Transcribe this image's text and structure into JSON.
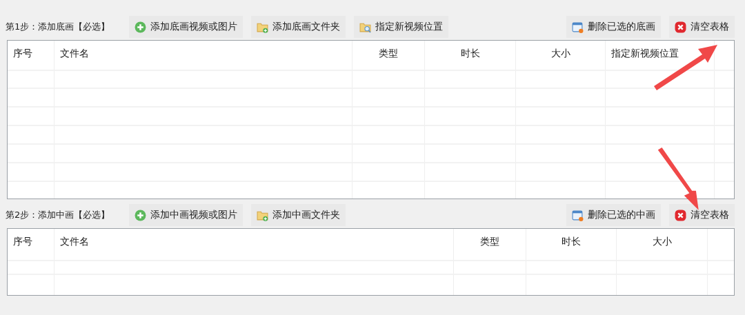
{
  "sections": [
    {
      "step_label": "第1步：添加底画【必选】",
      "left_buttons": [
        {
          "kind": "add",
          "label": "添加底画视频或图片"
        },
        {
          "kind": "folder",
          "label": "添加底画文件夹"
        },
        {
          "kind": "locate",
          "label": "指定新视频位置"
        }
      ],
      "right_buttons": [
        {
          "kind": "remove",
          "label": "删除已选的底画"
        },
        {
          "kind": "clear",
          "label": "清空表格"
        }
      ],
      "table": {
        "columns": [
          "序号",
          "文件名",
          "类型",
          "时长",
          "大小",
          "指定新视频位置"
        ]
      }
    },
    {
      "step_label": "第2步：添加中画【必选】",
      "left_buttons": [
        {
          "kind": "add",
          "label": "添加中画视频或图片"
        },
        {
          "kind": "folder",
          "label": "添加中画文件夹"
        }
      ],
      "right_buttons": [
        {
          "kind": "remove",
          "label": "删除已选的中画"
        },
        {
          "kind": "clear",
          "label": "清空表格"
        }
      ],
      "table": {
        "columns": [
          "序号",
          "文件名",
          "类型",
          "时长",
          "大小"
        ]
      }
    }
  ]
}
